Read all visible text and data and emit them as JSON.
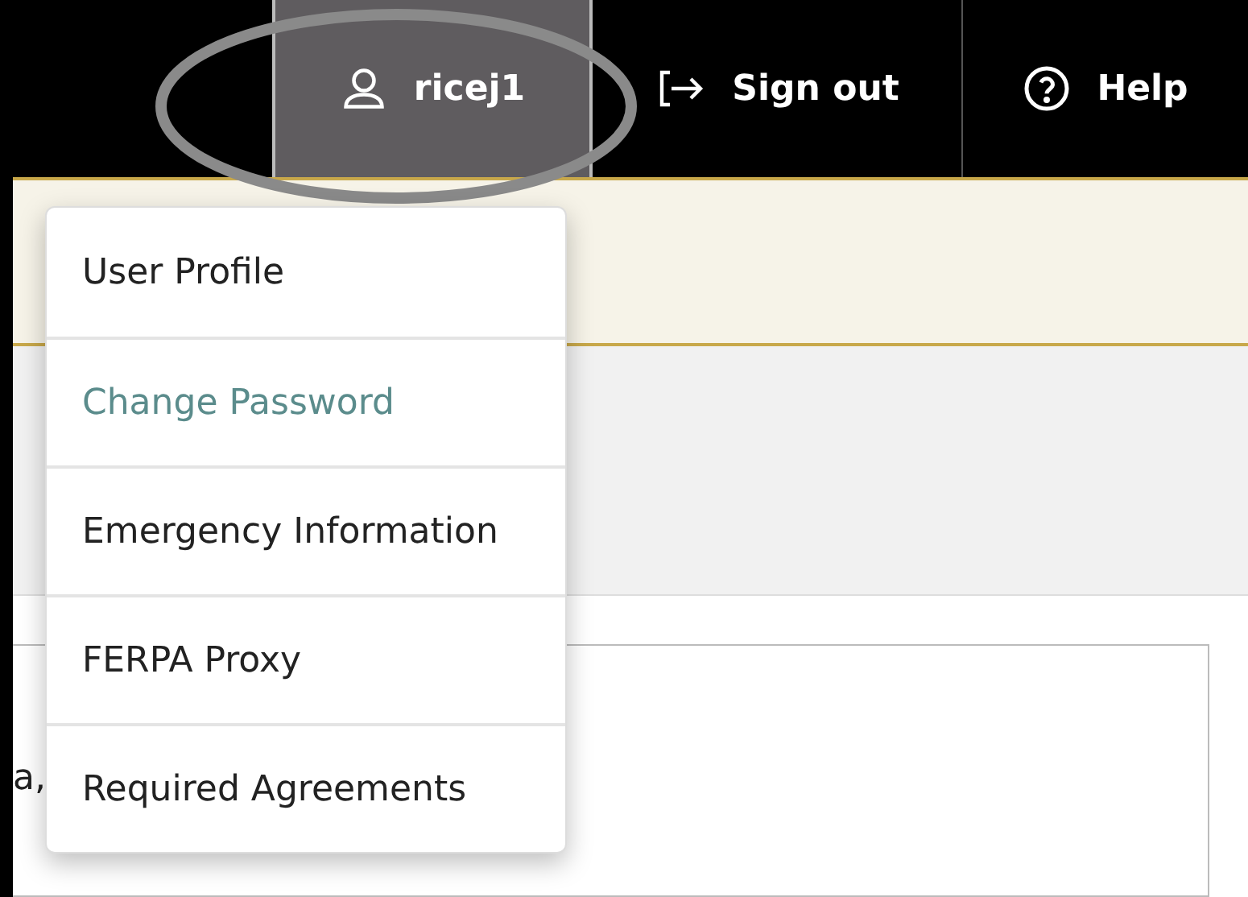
{
  "top_bar": {
    "user_button": {
      "label": "ricej1",
      "selected": true
    },
    "sign_out": {
      "label": "Sign out"
    },
    "help": {
      "label": "Help"
    }
  },
  "user_menu": {
    "items": [
      {
        "label": "User Profile",
        "selected": false
      },
      {
        "label": "Change Password",
        "selected": true
      },
      {
        "label": "Emergency Information",
        "selected": false
      },
      {
        "label": "FERPA Proxy",
        "selected": false
      },
      {
        "label": "Required Agreements",
        "selected": false
      }
    ]
  },
  "content": {
    "fragment": "a,"
  }
}
